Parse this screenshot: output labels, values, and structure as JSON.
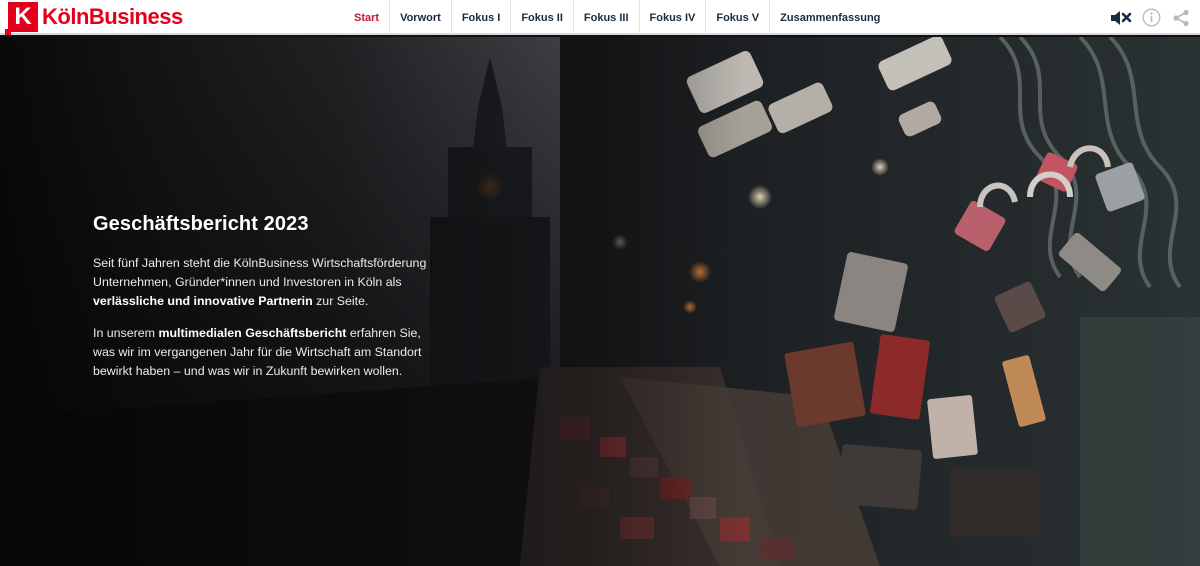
{
  "header": {
    "logo_letter": "K",
    "logo_text": "KölnBusiness",
    "nav": [
      {
        "label": "Start",
        "active": true
      },
      {
        "label": "Vorwort",
        "active": false
      },
      {
        "label": "Fokus I",
        "active": false
      },
      {
        "label": "Fokus II",
        "active": false
      },
      {
        "label": "Fokus III",
        "active": false
      },
      {
        "label": "Fokus IV",
        "active": false
      },
      {
        "label": "Fokus V",
        "active": false
      },
      {
        "label": "Zusammenfassung",
        "active": false
      }
    ],
    "tools": [
      "mute-icon",
      "info-icon",
      "share-icon"
    ]
  },
  "hero": {
    "title": "Geschäftsbericht 2023",
    "p1_pre": "Seit fünf Jahren steht die KölnBusiness Wirtschaftsförderung Unternehmen, Gründer*innen und Investoren in Köln als ",
    "p1_bold": "verlässliche und innovative Partnerin",
    "p1_post": " zur Seite.",
    "p2_pre": "In unserem ",
    "p2_bold": "multimedialen Geschäftsbericht",
    "p2_post": " erfahren Sie, was wir im vergangenen Jahr für die Wirtschaft am Standort bewirkt haben – und was wir in Zukunft bewirken wollen."
  },
  "colors": {
    "brand_red": "#e3001b",
    "nav_active": "#c4162f",
    "nav_text": "#1a2a44"
  }
}
